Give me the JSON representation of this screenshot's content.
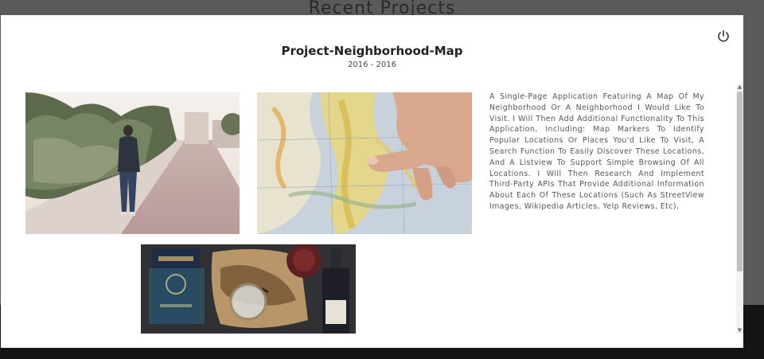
{
  "background": {
    "heading": "Recent Projects"
  },
  "modal": {
    "title": "Project-Neighborhood-Map",
    "dates": "2016 - 2016",
    "description": "A Single-Page Application Featuring A Map Of My Neighborhood Or A Neighborhood I Would Like To Visit. I Will Then Add Additional Functionality To This Application, Including: Map Markers To Identify Popular Locations Or Places You'd Like To Visit, A Search Function To Easily Discover These Locations, And A Listview To Support Simple Browsing Of All Locations. I Will Then Research And Implement Third-Party APIs That Provide Additional Information About Each Of These Locations (Such As StreetView Images, Wikipedia Articles, Yelp Reviews, Etc).",
    "close_icon": "power-icon",
    "images": [
      {
        "name": "walking-street-photo"
      },
      {
        "name": "map-hand-photo"
      },
      {
        "name": "passport-map-wine-photo"
      }
    ]
  },
  "colors": {
    "overlay": "#5a5a5a",
    "footer": "#141414",
    "modal_bg": "#ffffff",
    "title_text": "#222222",
    "body_text": "#555555"
  }
}
